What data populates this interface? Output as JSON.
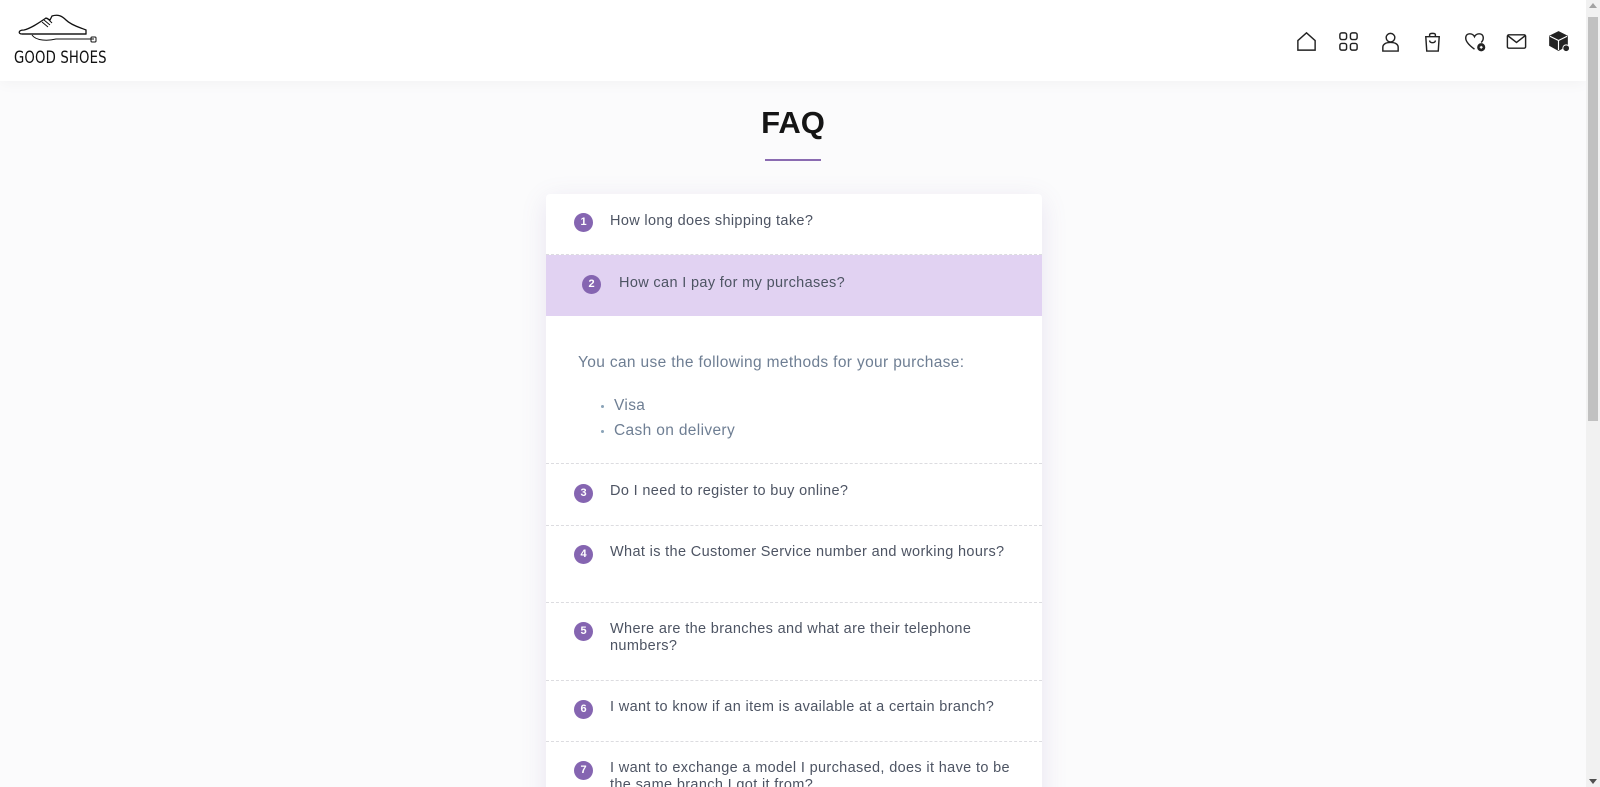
{
  "brand": {
    "name": "GOOD SHOES"
  },
  "nav": [
    {
      "name": "home-icon"
    },
    {
      "name": "grid-icon"
    },
    {
      "name": "user-icon"
    },
    {
      "name": "shopping-bag-icon"
    },
    {
      "name": "wishlist-icon"
    },
    {
      "name": "mail-icon"
    },
    {
      "name": "package-icon"
    }
  ],
  "page": {
    "title": "FAQ"
  },
  "faq": {
    "items": [
      {
        "num": "1",
        "question": "How long does shipping take?"
      },
      {
        "num": "2",
        "question": "How can I pay for my purchases?"
      },
      {
        "num": "3",
        "question": "Do I need to register to buy online?"
      },
      {
        "num": "4",
        "question": "What is the Customer Service number and working hours?"
      },
      {
        "num": "5",
        "question": "Where are the branches and what are their telephone numbers?"
      },
      {
        "num": "6",
        "question": "I want to know if an item is available at a certain branch?"
      },
      {
        "num": "7",
        "question": "I want to exchange a model I purchased, does it have to be the same branch I got it from?"
      }
    ],
    "active_index": 1,
    "answer": {
      "intro": "You can use the following methods for your purchase:",
      "methods": [
        "Visa",
        "Cash on delivery"
      ]
    }
  },
  "colors": {
    "accent": "#8565b1",
    "active_bg": "#e1d2f2",
    "question_text": "#4d5463",
    "answer_text": "#6e7e93"
  }
}
